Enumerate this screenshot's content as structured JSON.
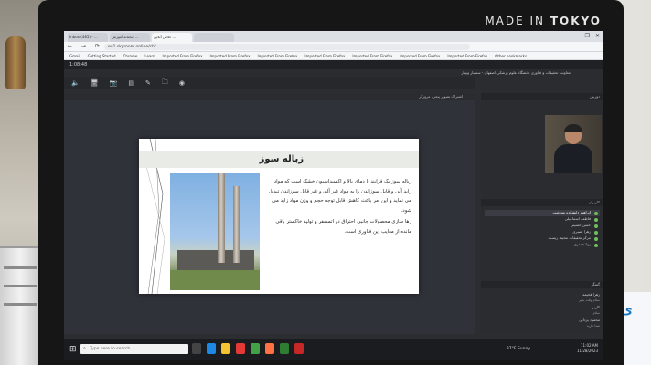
{
  "monitor": {
    "brand_prefix": "MADE IN ",
    "brand_bold": "TOKYO"
  },
  "browser": {
    "tabs": [
      "Inbox (485) - ...",
      "سامانه آموزش ...",
      "کلاس آنلاین ...",
      ""
    ],
    "window_controls": [
      "—",
      "❐",
      "✕"
    ],
    "nav_icons": "← → ⟳",
    "url": "eu1.skyroom.online/ch/...",
    "bookmarks": [
      "Gmail",
      "Getting Started",
      "Chrome",
      "Learn",
      "Imported From Firefox",
      "Imported From Firefox",
      "Imported From Firefox",
      "Imported From Firefox",
      "Imported From Firefox",
      "Imported From Firefox",
      "Imported From Firefox",
      "Other bookmarks"
    ]
  },
  "app": {
    "timer": "1:08:48",
    "meeting_title": "معاونت تحقیقات و فناوری دانشگاه علوم پزشکی اصفهان - سمینار وبینار",
    "toolbar_icons": [
      "🔈",
      "🖥",
      "📷",
      "▤",
      "✎",
      "🗀",
      "◉"
    ],
    "stage_label": "اشتراک تصویر پنجره مرورگر",
    "camera_panel_label": "دوربین",
    "users_panel_label": "کاربران",
    "chat_panel_label": "گفتگو"
  },
  "slide": {
    "title": "زباله سوز",
    "paragraph1": "زباله سوز یک فرایند با دمای بالا و اکسیداسیون خشک است که مواد زاید آلی و قابل سوزاندن را به مواد غیر آلی و غیر قابل سوزاندن تبدیل می نماید و این امر باعث کاهش قابل توجه حجم و وزن مواد زاید می شود.",
    "paragraph2": "رها سازی محصولات جانبی احتراق در اتمسفر و تولید خاکستر باقی مانده از معایب این فناوری است."
  },
  "participants": [
    {
      "name": "ابراهیم دانشکده بهداشت",
      "highlight": true
    },
    {
      "name": "فاطمه اسماعیلی",
      "highlight": false
    },
    {
      "name": "حسن حسینی",
      "highlight": false
    },
    {
      "name": "زهرا نصیری",
      "highlight": false
    },
    {
      "name": "مرکز تحقیقات محیط زیست",
      "highlight": false
    },
    {
      "name": "پویا جعفری",
      "highlight": false
    }
  ],
  "chat": [
    {
      "msg": "زهرا فخیمه",
      "sub": "سلام وقت بخیر"
    },
    {
      "msg": "کاربر",
      "sub": "سلام"
    },
    {
      "msg": "محمود یزدانی",
      "sub": "صدا دارید"
    }
  ],
  "taskbar": {
    "start_icon": "⊞",
    "search_icon": "⌕",
    "search_placeholder": "Type here to search",
    "weather": "37°F Sunny",
    "time": "11:02 AM",
    "date": "11/28/2023"
  },
  "colors": {
    "accent": "#3fa7ff",
    "online_dot": "#6fbf5a"
  }
}
